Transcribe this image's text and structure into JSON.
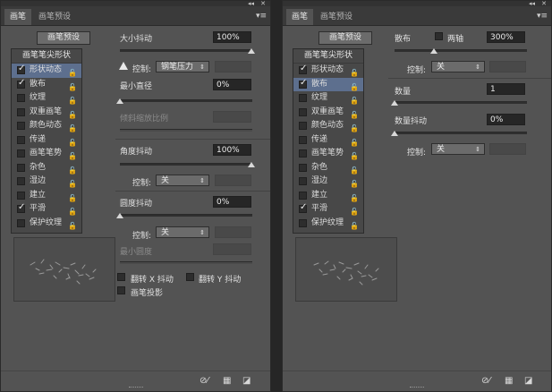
{
  "common": {
    "tabs": [
      "画笔",
      "画笔预设"
    ],
    "preset_button": "画笔预设",
    "list_header": "画笔笔尖形状",
    "control_label": "控制:",
    "lock_glyph": "🔓"
  },
  "left": {
    "list": [
      {
        "label": "形状动态",
        "checked": true,
        "selected": true
      },
      {
        "label": "散布",
        "checked": true,
        "selected": false
      },
      {
        "label": "纹理",
        "checked": false,
        "selected": false
      },
      {
        "label": "双重画笔",
        "checked": false,
        "selected": false
      },
      {
        "label": "颜色动态",
        "checked": false,
        "selected": false
      },
      {
        "label": "传递",
        "checked": false,
        "selected": false
      },
      {
        "label": "画笔笔势",
        "checked": false,
        "selected": false
      },
      {
        "label": "杂色",
        "checked": false,
        "selected": false
      },
      {
        "label": "湿边",
        "checked": false,
        "selected": false
      },
      {
        "label": "建立",
        "checked": false,
        "selected": false
      },
      {
        "label": "平滑",
        "checked": true,
        "selected": false
      },
      {
        "label": "保护纹理",
        "checked": false,
        "selected": false
      }
    ],
    "size_jitter": {
      "label": "大小抖动",
      "value": "100%"
    },
    "size_control": {
      "select": "钢笔压力"
    },
    "min_diameter": {
      "label": "最小直径",
      "value": "0%"
    },
    "tilt_scale": {
      "label": "倾斜缩放比例"
    },
    "angle_jitter": {
      "label": "角度抖动",
      "value": "100%"
    },
    "angle_control": {
      "select": "关"
    },
    "roundness_jitter": {
      "label": "圆度抖动",
      "value": "0%"
    },
    "roundness_control": {
      "select": "关"
    },
    "min_roundness": {
      "label": "最小圆度"
    },
    "flip_x": {
      "label": "翻转 X 抖动",
      "checked": false
    },
    "flip_y": {
      "label": "翻转 Y 抖动",
      "checked": false
    },
    "brush_projection": {
      "label": "画笔投影",
      "checked": false
    }
  },
  "right": {
    "list": [
      {
        "label": "形状动态",
        "checked": true,
        "selected": false
      },
      {
        "label": "散布",
        "checked": true,
        "selected": true
      },
      {
        "label": "纹理",
        "checked": false,
        "selected": false
      },
      {
        "label": "双重画笔",
        "checked": false,
        "selected": false
      },
      {
        "label": "颜色动态",
        "checked": false,
        "selected": false
      },
      {
        "label": "传递",
        "checked": false,
        "selected": false
      },
      {
        "label": "画笔笔势",
        "checked": false,
        "selected": false
      },
      {
        "label": "杂色",
        "checked": false,
        "selected": false
      },
      {
        "label": "湿边",
        "checked": false,
        "selected": false
      },
      {
        "label": "建立",
        "checked": false,
        "selected": false
      },
      {
        "label": "平滑",
        "checked": true,
        "selected": false
      },
      {
        "label": "保护纹理",
        "checked": false,
        "selected": false
      }
    ],
    "scatter": {
      "label": "散布",
      "both_axes_label": "两轴",
      "both_axes_checked": false,
      "value": "300%"
    },
    "scatter_control": {
      "select": "关"
    },
    "count": {
      "label": "数量",
      "value": "1"
    },
    "count_jitter": {
      "label": "数量抖动",
      "value": "0%"
    },
    "count_control": {
      "select": "关"
    }
  }
}
